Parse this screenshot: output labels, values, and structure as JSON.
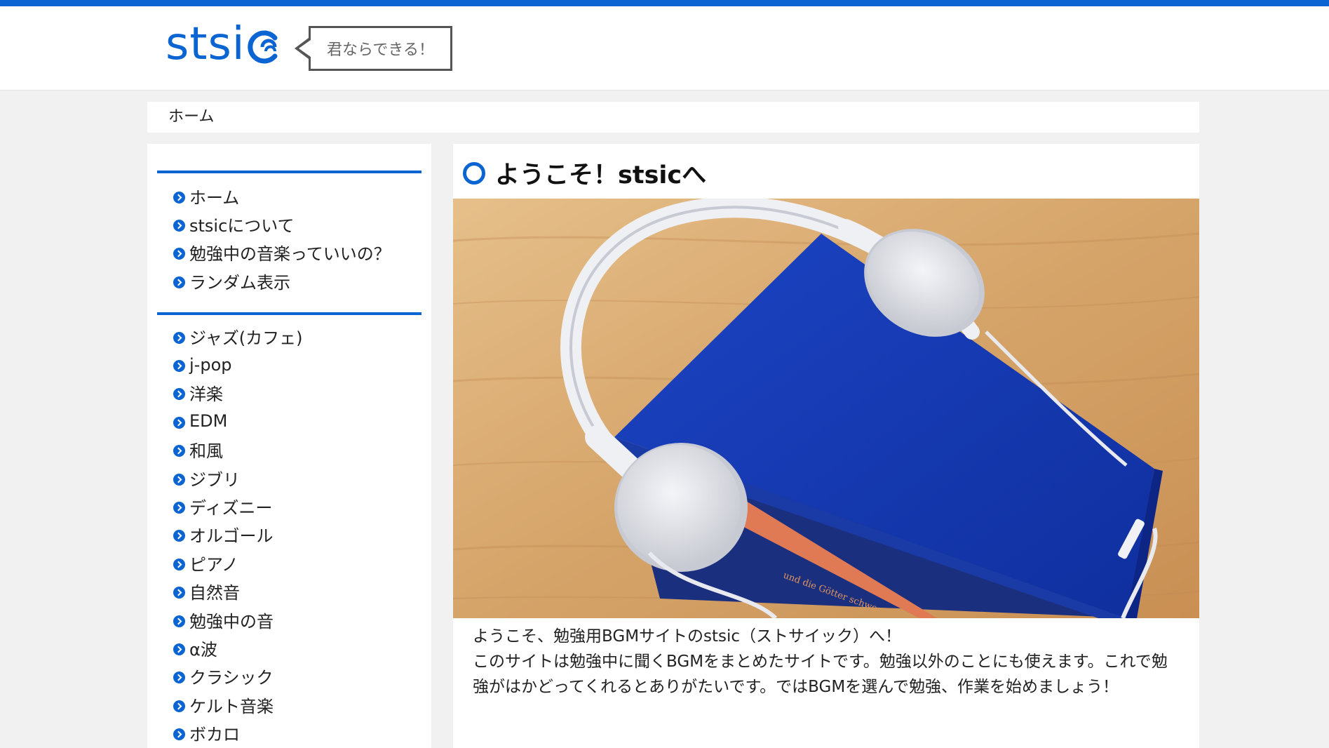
{
  "header": {
    "logo_text": "stsi",
    "tagline": "君ならできる！"
  },
  "breadcrumb": {
    "home": "ホーム"
  },
  "sidebar": {
    "menu": [
      {
        "label": "ホーム"
      },
      {
        "label": "stsicについて"
      },
      {
        "label": "勉強中の音楽っていいの？"
      },
      {
        "label": "ランダム表示"
      }
    ],
    "categories": [
      {
        "label": "ジャズ(カフェ)"
      },
      {
        "label": "j-pop"
      },
      {
        "label": "洋楽"
      },
      {
        "label": "EDM"
      },
      {
        "label": "和風"
      },
      {
        "label": "ジブリ"
      },
      {
        "label": "ディズニー"
      },
      {
        "label": "オルゴール"
      },
      {
        "label": "ピアノ"
      },
      {
        "label": "自然音"
      },
      {
        "label": "勉強中の音"
      },
      {
        "label": "α波"
      },
      {
        "label": "クラシック"
      },
      {
        "label": "ケルト音楽"
      },
      {
        "label": "ボカロ"
      }
    ]
  },
  "main": {
    "title": "ようこそ！stsicへ",
    "intro_line1": "ようこそ、勉強用BGMサイトのstsic（ストサイック）へ！",
    "intro_line2": "このサイトは勉強中に聞くBGMをまとめたサイトです。勉強以外のことにも使えます。これで勉強がはかどってくれるとありがたいです。ではBGMを選んで勉強、作業を始めましょう！",
    "book_spine_text": "und die Götter schwe"
  },
  "colors": {
    "accent": "#0a64d2",
    "background": "#f1f1f1",
    "book_blue": "#1339b0",
    "wood": "#d9aa70"
  }
}
